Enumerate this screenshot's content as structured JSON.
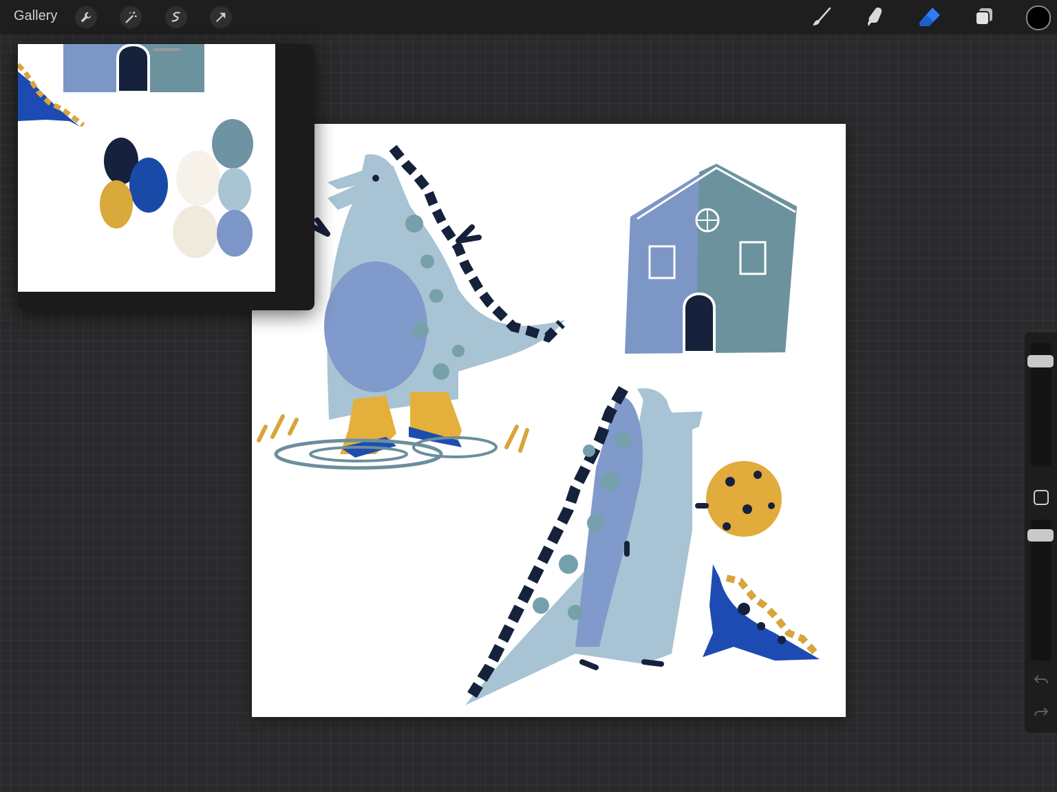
{
  "topbar": {
    "gallery_label": "Gallery",
    "left_tools": [
      "wrench-icon",
      "magic-wand-icon",
      "selection-icon",
      "transform-arrow-icon"
    ],
    "right_tools": [
      "brush-icon",
      "smudge-icon",
      "eraser-icon",
      "layers-icon"
    ],
    "active_tool": "eraser-icon",
    "active_color": "#000000",
    "accent": "#2f7cf6"
  },
  "sidebar": {
    "brush_size_level": 0.94,
    "opacity_level": 0.96,
    "icons": [
      "undo-icon",
      "redo-icon"
    ]
  },
  "reference_panel": {
    "palette_colors": [
      "#15213d",
      "#1a4aa8",
      "#d8a93b",
      "#f6f2ea",
      "#f0eadc",
      "#6e93a3",
      "#a9c4d3",
      "#7c96c8"
    ]
  },
  "artwork": {
    "colors": {
      "dino_light": "#a8c3d3",
      "dino_belly": "#7f9acb",
      "spots": "#76a0ab",
      "spikes": "#16213b",
      "boots": "#e4b03b",
      "boot_sole": "#1e4db0",
      "house_left": "#7c96c6",
      "house_right": "#6c939d",
      "ball": "#e1ac3c",
      "small_dino": "#1d4bb3",
      "water": "#6a8f9c",
      "grass": "#d9a43a"
    }
  }
}
